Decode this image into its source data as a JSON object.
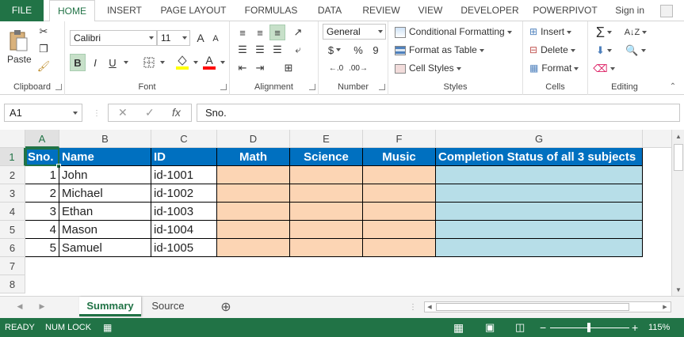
{
  "ribbon_tabs": [
    "FILE",
    "HOME",
    "INSERT",
    "PAGE LAYOUT",
    "FORMULAS",
    "DATA",
    "REVIEW",
    "VIEW",
    "DEVELOPER",
    "POWERPIVOT"
  ],
  "active_tab": "HOME",
  "signin": "Sign in",
  "clipboard": {
    "paste_label": "Paste",
    "group_label": "Clipboard"
  },
  "font": {
    "name": "Calibri",
    "size": "11",
    "group_label": "Font",
    "bold": "B",
    "italic": "I",
    "underline": "U",
    "grow": "A",
    "shrink": "A",
    "color": "A"
  },
  "alignment": {
    "group_label": "Alignment"
  },
  "number": {
    "format": "General",
    "group_label": "Number",
    "currency": "$",
    "percent": "%",
    "comma": "9"
  },
  "styles": {
    "conditional": "Conditional Formatting",
    "format_table": "Format as Table",
    "cell_styles": "Cell Styles",
    "group_label": "Styles"
  },
  "cells": {
    "insert": "Insert",
    "delete": "Delete",
    "format": "Format",
    "group_label": "Cells"
  },
  "editing": {
    "group_label": "Editing"
  },
  "formula_bar": {
    "name_box": "A1",
    "cancel": "✕",
    "enter": "✓",
    "fx": "fx",
    "content": "Sno."
  },
  "columns": [
    "A",
    "B",
    "C",
    "D",
    "E",
    "F",
    "G"
  ],
  "rows": [
    "1",
    "2",
    "3",
    "4",
    "5",
    "6",
    "7",
    "8"
  ],
  "table": {
    "headers": [
      "Sno.",
      "Name",
      "ID",
      "Math",
      "Science",
      "Music",
      "Completion Status of all 3 subjects"
    ],
    "records": [
      {
        "sno": "1",
        "name": "John",
        "id": "id-1001"
      },
      {
        "sno": "2",
        "name": "Michael",
        "id": "id-1002"
      },
      {
        "sno": "3",
        "name": "Ethan",
        "id": "id-1003"
      },
      {
        "sno": "4",
        "name": "Mason",
        "id": "id-1004"
      },
      {
        "sno": "5",
        "name": "Samuel",
        "id": "id-1005"
      }
    ]
  },
  "sheets": [
    "Summary",
    "Source"
  ],
  "active_sheet": "Summary",
  "add_sheet": "⊕",
  "status": {
    "ready": "READY",
    "numlock": "NUM LOCK",
    "zoom": "115%",
    "zoom_minus": "−",
    "zoom_plus": "+"
  },
  "colors": {
    "excel_green": "#217346",
    "header_blue": "#0070c0",
    "peach": "#fcd5b4",
    "light_blue": "#b7dee8"
  }
}
